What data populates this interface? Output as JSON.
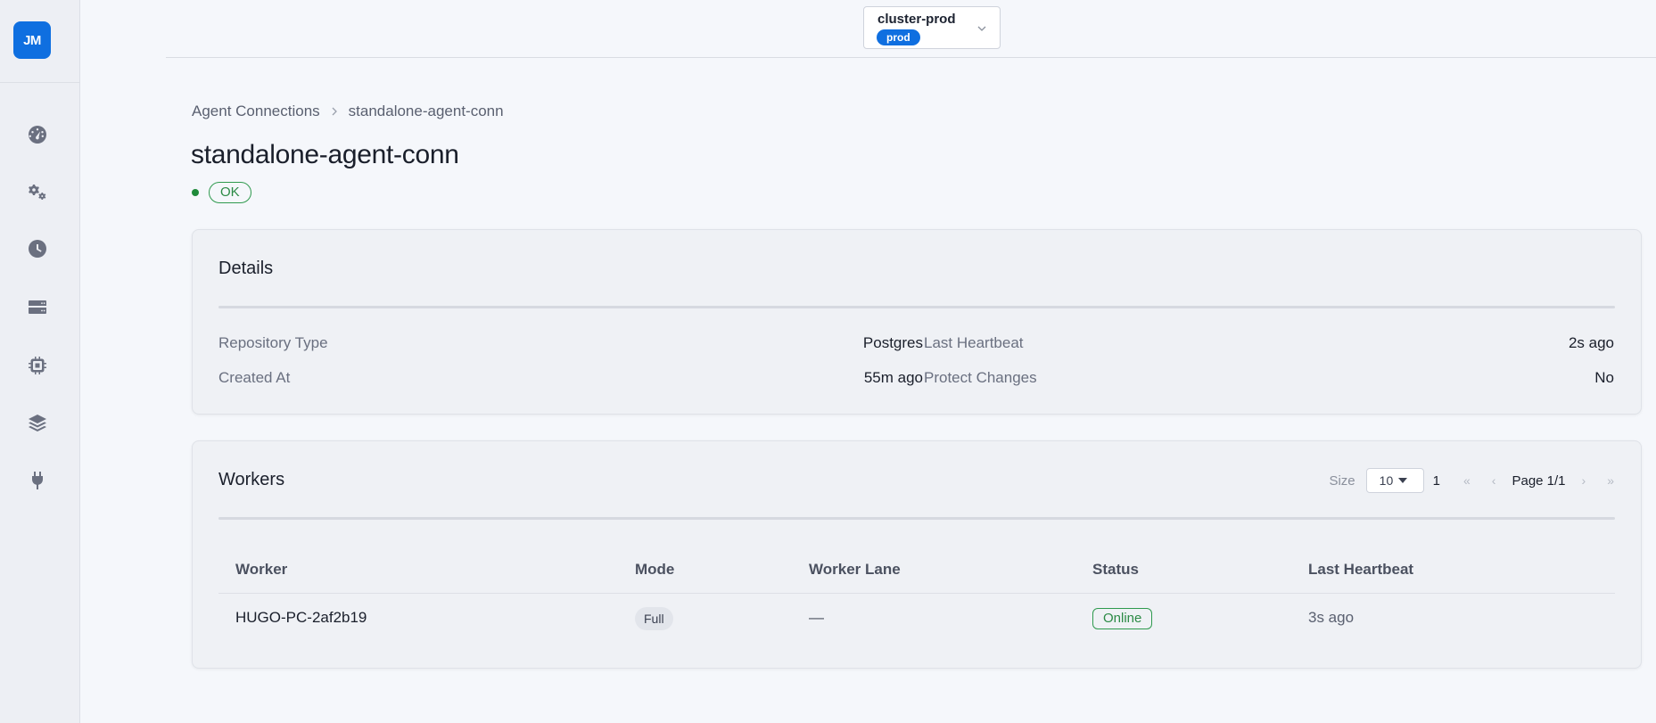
{
  "sidebar": {
    "logo_text": "JM",
    "icons": [
      "dashboard-gauge-icon",
      "gears-icon",
      "clock-icon",
      "server-icon",
      "chip-icon",
      "layers-icon",
      "plug-icon"
    ]
  },
  "topbar": {
    "cluster_name": "cluster-prod",
    "cluster_badge": "prod"
  },
  "breadcrumb": {
    "parent": "Agent Connections",
    "current": "standalone-agent-conn"
  },
  "header": {
    "title": "standalone-agent-conn",
    "status": "OK"
  },
  "details": {
    "title": "Details",
    "repository_type_label": "Repository Type",
    "repository_type_value": "Postgres",
    "created_at_label": "Created At",
    "created_at_value": "55m ago",
    "last_heartbeat_label": "Last Heartbeat",
    "last_heartbeat_value": "2s ago",
    "protect_changes_label": "Protect Changes",
    "protect_changes_value": "No"
  },
  "workers": {
    "title": "Workers",
    "pager": {
      "size_label": "Size",
      "size_value": "10",
      "page_number": "1",
      "first": "«",
      "prev": "‹",
      "page_info": "Page 1/1",
      "next": "›",
      "last": "»"
    },
    "columns": [
      "Worker",
      "Mode",
      "Worker Lane",
      "Status",
      "Last Heartbeat"
    ],
    "rows": [
      {
        "worker": "HUGO-PC-2af2b19",
        "mode": "Full",
        "lane": "—",
        "status": "Online",
        "last_heartbeat": "3s ago"
      }
    ]
  },
  "colors": {
    "accent": "#0f6fe0",
    "success": "#2b8a45"
  }
}
